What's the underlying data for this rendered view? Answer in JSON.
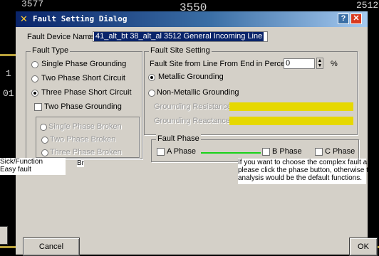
{
  "background": {
    "numbers": [
      "3577",
      "3550",
      "2512",
      "1",
      "01"
    ],
    "left_overlay": [
      "Sick/Function",
      "Easy fault"
    ],
    "left_overlay_mid": "Br"
  },
  "dialog": {
    "title": "Fault Setting Dialog",
    "help_label": "?",
    "close_label": "✕",
    "device_label": "Fault Device Name",
    "device_value": "41_alt_bt 38_alt_al 3512 General Incoming Line",
    "fault_type": {
      "title": "Fault Type",
      "options": [
        {
          "label": "Single Phase Grounding",
          "selected": false
        },
        {
          "label": "Two Phase Short Circuit",
          "selected": false
        },
        {
          "label": "Three Phase Short Circuit",
          "selected": true
        }
      ],
      "two_phase_grounding": "Two Phase Grounding",
      "broken_options": [
        "Single Phase Broken",
        "Two Phase Broken",
        "Three Phase Broken"
      ]
    },
    "fault_site": {
      "title": "Fault Site Setting",
      "distance_label": "Fault Site from Line From End in Percent",
      "distance_value": "0",
      "distance_unit": "%",
      "options": [
        {
          "label": "Metallic Grounding",
          "selected": true
        },
        {
          "label": "Non-Metallic Grounding",
          "selected": false
        }
      ],
      "grounding_resistance_label": "Grounding Resistance",
      "grounding_reactance_label": "Grounding Reactance"
    },
    "fault_phase": {
      "title": "Fault Phase",
      "phases": [
        "A Phase",
        "B Phase",
        "C Phase"
      ]
    },
    "help_note": [
      "If you want to choose the complex fault analysis,",
      "please click the phase button, otherwise the",
      "analysis would be the default functions."
    ],
    "cancel_label": "Cancel",
    "ok_label": "OK"
  },
  "colors": {
    "title_start": "#0a246a",
    "title_end": "#a6caf0",
    "highlight": "#e6d800",
    "panel": "#d4d0c8"
  }
}
